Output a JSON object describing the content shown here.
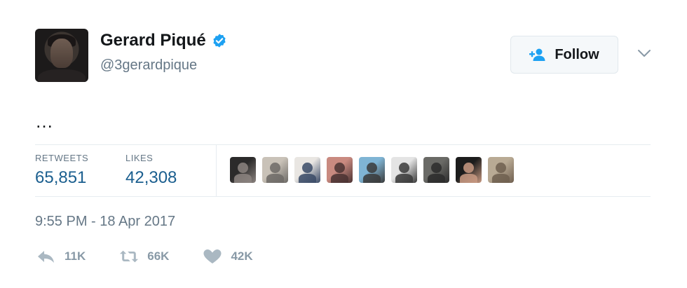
{
  "user": {
    "display_name": "Gerard Piqué",
    "handle": "@3gerardpique",
    "verified": true,
    "avatar_icon": "profile-photo"
  },
  "follow_button": {
    "label": "Follow",
    "icon": "add-user-icon"
  },
  "menu": {
    "icon": "chevron-down-icon"
  },
  "tweet": {
    "text": "…"
  },
  "stats": {
    "retweets_label": "RETWEETS",
    "retweets_value": "65,851",
    "likes_label": "LIKES",
    "likes_value": "42,308"
  },
  "likers": [
    {
      "name": "liker-1",
      "colors": [
        "#2b2a2a",
        "#8c8480"
      ]
    },
    {
      "name": "liker-2",
      "colors": [
        "#c9c2b8",
        "#6d6a66"
      ]
    },
    {
      "name": "liker-3",
      "colors": [
        "#e9e6e2",
        "#3a4a66"
      ]
    },
    {
      "name": "liker-4",
      "colors": [
        "#c98a80",
        "#4a3232"
      ]
    },
    {
      "name": "liker-5",
      "colors": [
        "#7fb4d4",
        "#3a3a3a"
      ]
    },
    {
      "name": "liker-6",
      "colors": [
        "#e4e4e4",
        "#3a3a3a"
      ]
    },
    {
      "name": "liker-7",
      "colors": [
        "#6a6a66",
        "#2c2c2c"
      ]
    },
    {
      "name": "liker-8",
      "colors": [
        "#1c1c1c",
        "#c99a82"
      ]
    },
    {
      "name": "liker-9",
      "colors": [
        "#b9aa94",
        "#6f5f4f"
      ]
    }
  ],
  "timestamp": "9:55 PM - 18 Apr 2017",
  "actions": {
    "reply_count": "11K",
    "retweet_count": "66K",
    "like_count": "42K"
  },
  "colors": {
    "verified": "#1da1f2",
    "stat_value": "#1b5f8f",
    "muted": "#657786",
    "action_icon": "#aab8c2",
    "follow_icon": "#1da1f2"
  }
}
